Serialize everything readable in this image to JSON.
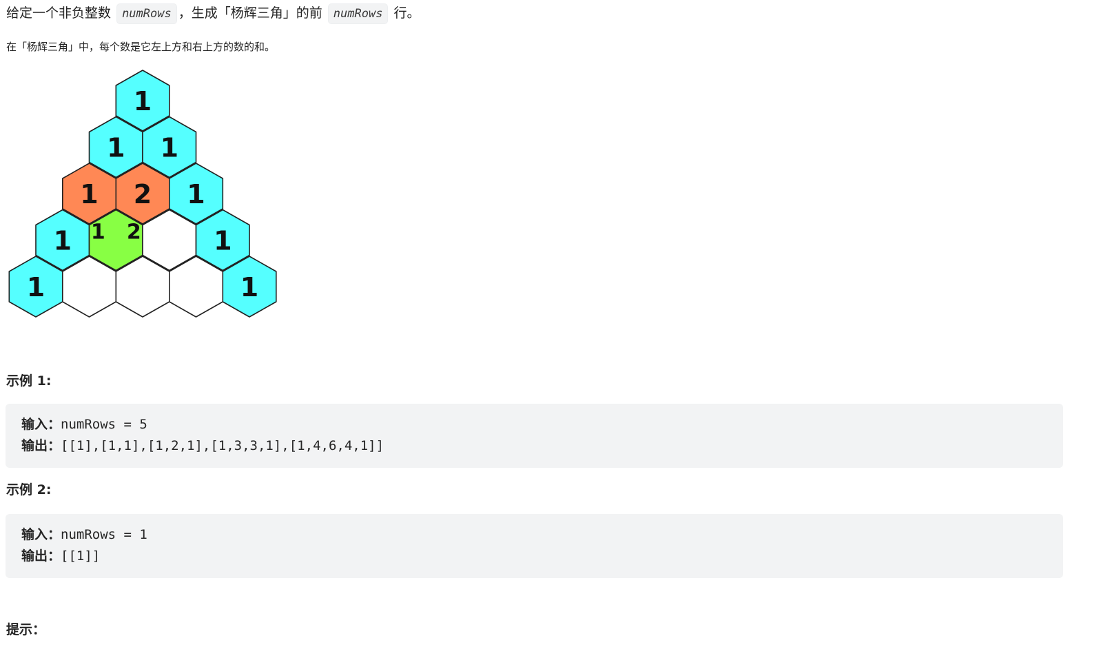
{
  "intro": {
    "prefix": "给定一个非负整数",
    "code1": "numRows",
    "middle": "，生成「杨辉三角」的前",
    "code2": "numRows",
    "suffix": "行。"
  },
  "note": "在「杨辉三角」中，每个数是它左上方和右上方的数的和。",
  "figure": {
    "colors": {
      "edge": "#55ffff",
      "parents": "#ff8855",
      "child": "#88ff44",
      "empty": "#ffffff",
      "outline": "#222222"
    },
    "rows": [
      [
        {
          "v": "1",
          "c": "edge"
        }
      ],
      [
        {
          "v": "1",
          "c": "edge"
        },
        {
          "v": "1",
          "c": "edge"
        }
      ],
      [
        {
          "v": "1",
          "c": "edge"
        },
        {
          "v": "2",
          "c": "parents"
        },
        {
          "v": "1",
          "c": "edge"
        }
      ],
      [
        {
          "v": "1",
          "c": "edge"
        },
        {
          "v": "",
          "c": "child"
        },
        {
          "v": "",
          "c": "empty"
        },
        {
          "v": "1",
          "c": "edge"
        }
      ],
      [
        {
          "v": "1",
          "c": "edge"
        },
        {
          "v": "",
          "c": "empty"
        },
        {
          "v": "",
          "c": "empty"
        },
        {
          "v": "",
          "c": "empty"
        },
        {
          "v": "1",
          "c": "edge"
        }
      ]
    ],
    "parent_override": {
      "row": 2,
      "col": 0,
      "c": "parents"
    },
    "child_labels": [
      "1",
      "2"
    ]
  },
  "examples": [
    {
      "title": "示例 1:",
      "input_label": "输入：",
      "input_value": "numRows = 5",
      "output_label": "输出：",
      "output_value": "[[1],[1,1],[1,2,1],[1,3,3,1],[1,4,6,4,1]]"
    },
    {
      "title": "示例 2:",
      "input_label": "输入：",
      "input_value": "numRows = 1",
      "output_label": "输出：",
      "output_value": "[[1]]"
    }
  ],
  "hint_title": "提示："
}
